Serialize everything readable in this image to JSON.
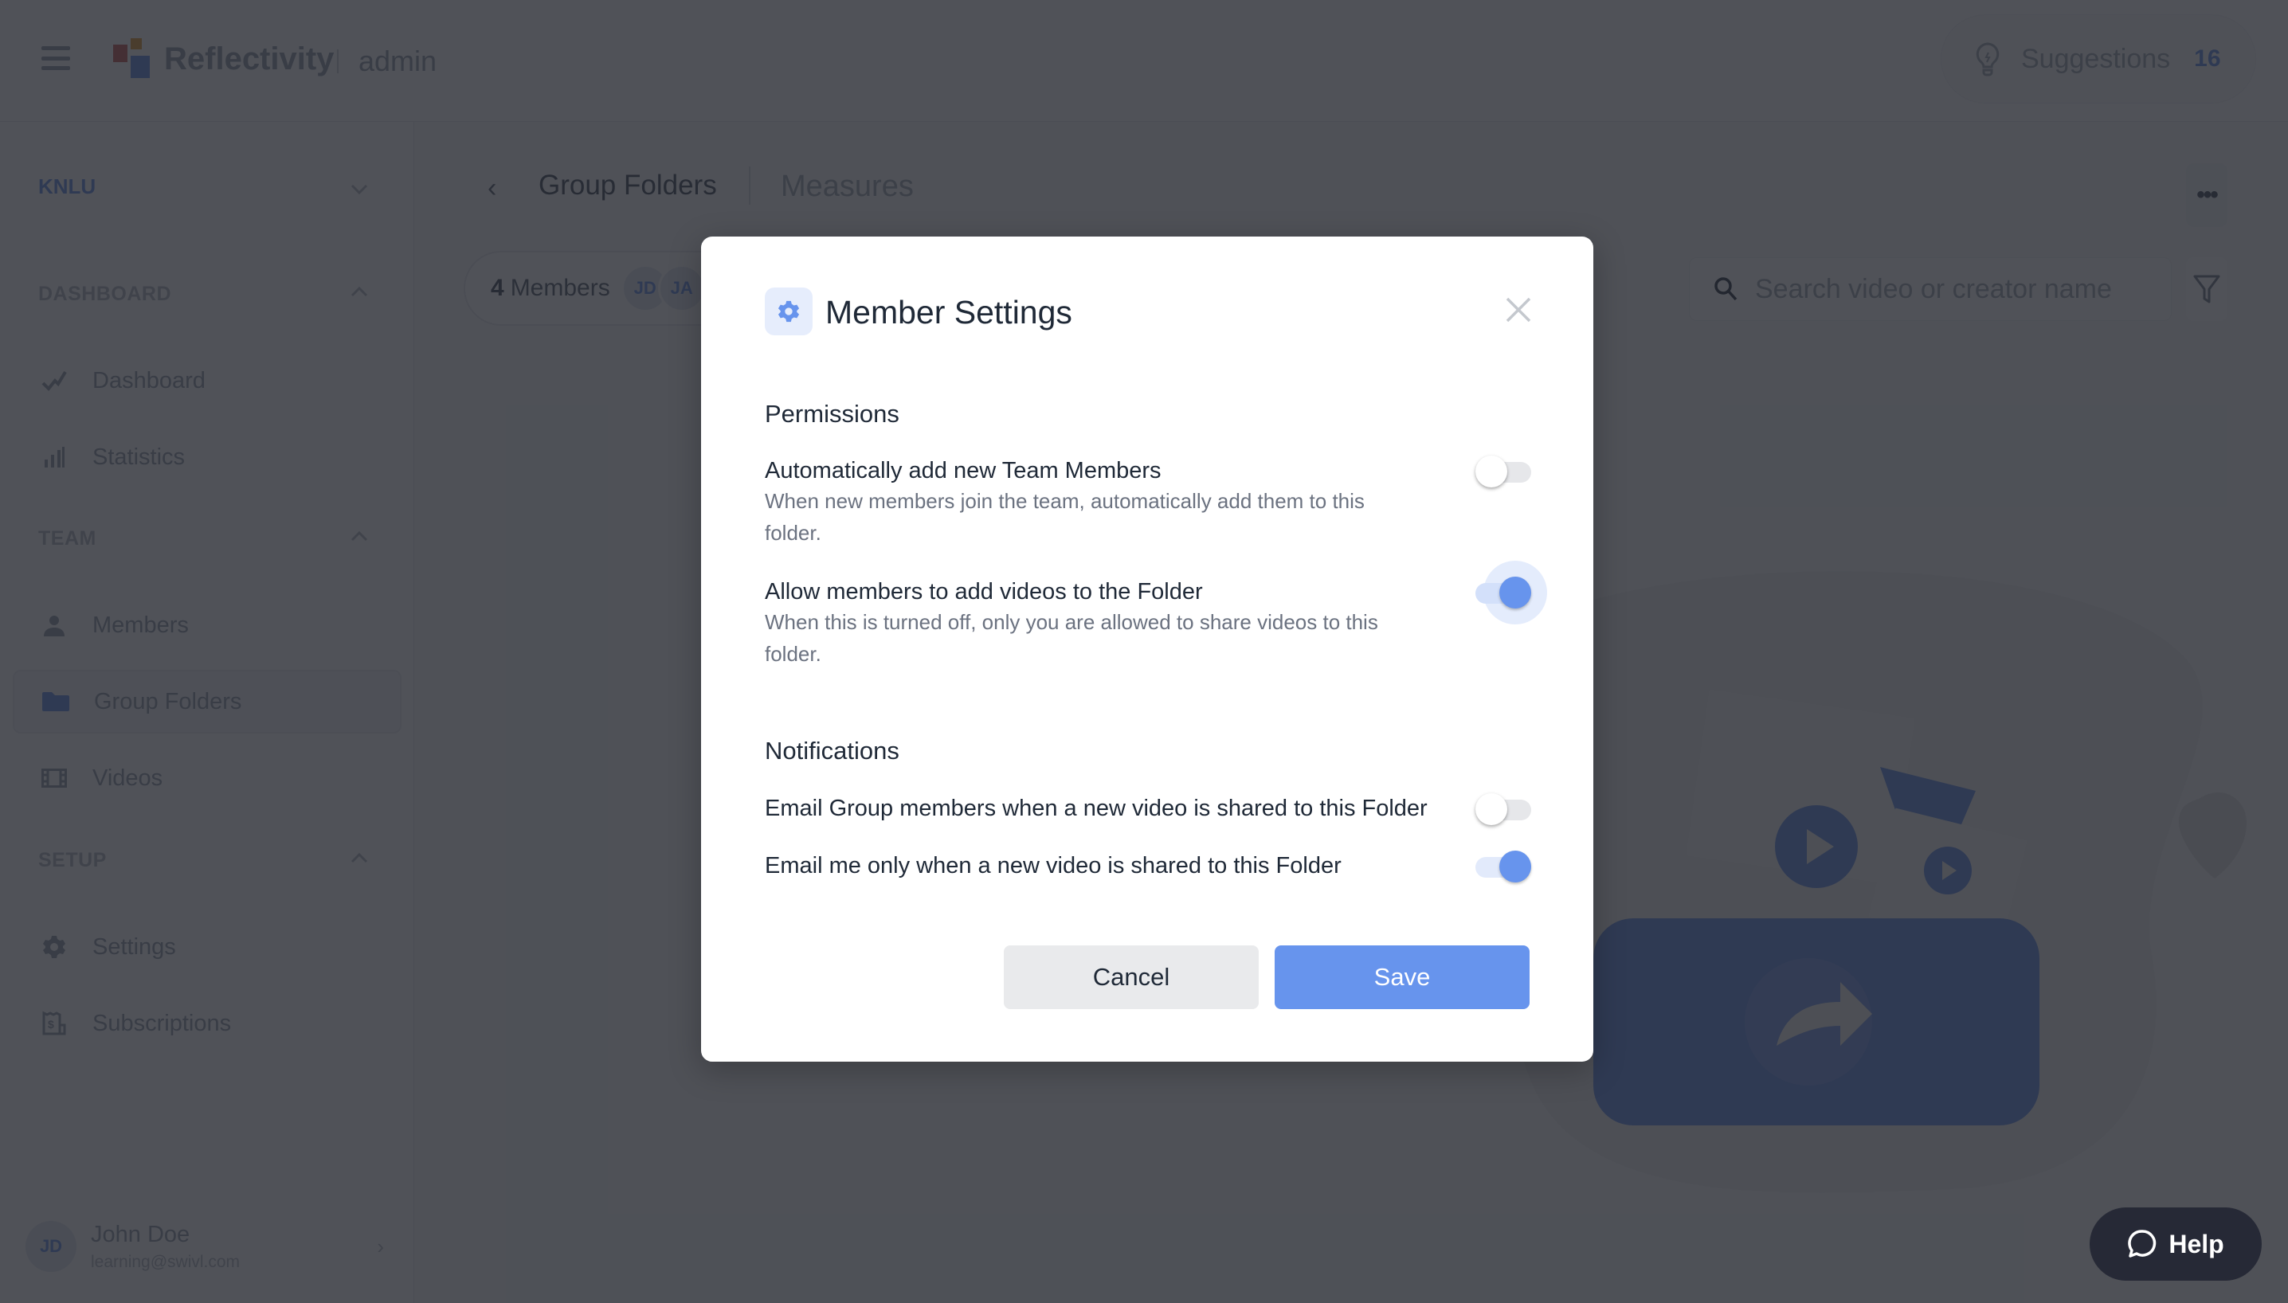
{
  "header": {
    "brand": "Reflectivity",
    "brand_sub": "admin",
    "suggestions_label": "Suggestions",
    "suggestions_count": "16"
  },
  "sidebar": {
    "team_name": "KNLU",
    "sections": [
      {
        "label": "DASHBOARD",
        "items": [
          {
            "label": "Dashboard",
            "icon": "trend-icon"
          },
          {
            "label": "Statistics",
            "icon": "bar-chart-icon"
          }
        ]
      },
      {
        "label": "TEAM",
        "items": [
          {
            "label": "Members",
            "icon": "person-icon"
          },
          {
            "label": "Group Folders",
            "icon": "folder-icon",
            "active": true
          },
          {
            "label": "Videos",
            "icon": "film-icon"
          }
        ]
      },
      {
        "label": "SETUP",
        "items": [
          {
            "label": "Settings",
            "icon": "gear-icon"
          },
          {
            "label": "Subscriptions",
            "icon": "receipt-icon"
          }
        ]
      }
    ],
    "user": {
      "initials": "JD",
      "name": "John Doe",
      "email": "learning@swivl.com"
    }
  },
  "main": {
    "breadcrumb_parent": "Group Folders",
    "breadcrumb_current": "Measures",
    "members_count": "4",
    "members_label": "Members",
    "member_avatars": [
      "JD",
      "JA"
    ],
    "search_placeholder": "Search video or creator name"
  },
  "modal": {
    "title": "Member Settings",
    "permissions_heading": "Permissions",
    "notifications_heading": "Notifications",
    "settings": [
      {
        "title": "Automatically add new Team Members",
        "description": "When new members join the team, automatically add them to this folder.",
        "enabled": false
      },
      {
        "title": "Allow members to add videos to the Folder",
        "description": "When this is turned off, only you are allowed to share videos to this folder.",
        "enabled": true
      },
      {
        "title": "Email Group members when a new video is shared to this Folder",
        "enabled": false
      },
      {
        "title": "Email me only when a new video is shared to this Folder",
        "enabled": true
      }
    ],
    "cancel_label": "Cancel",
    "save_label": "Save"
  },
  "help": {
    "label": "Help"
  },
  "colors": {
    "accent": "#6794ed",
    "overlay": "#24272e",
    "help_bg": "#262936"
  }
}
